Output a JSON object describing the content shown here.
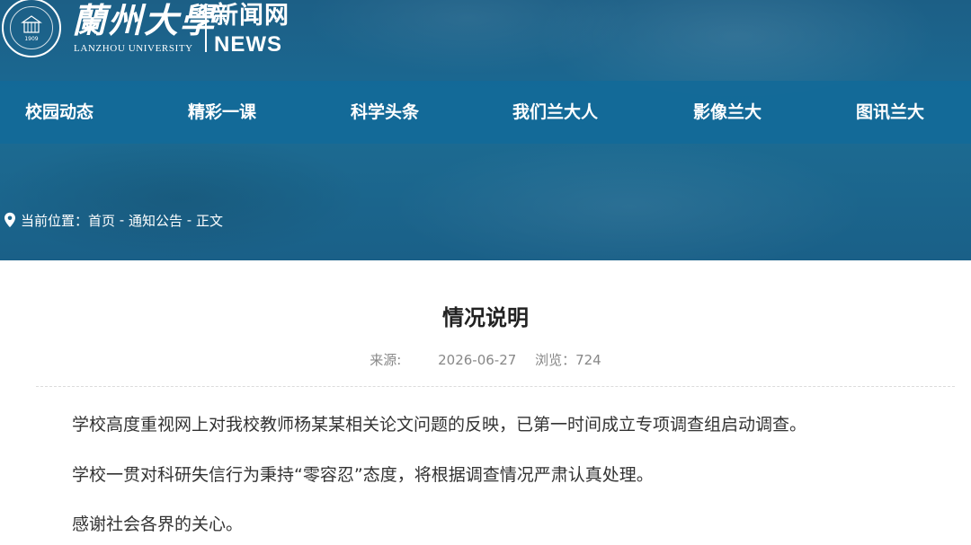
{
  "header": {
    "brand_cn": "蘭州大學",
    "brand_en": "LANZHOU UNIVERSITY",
    "news_cn": "新闻网",
    "news_en": "NEWS",
    "seal_year": "1909"
  },
  "nav": {
    "items": [
      {
        "label": "校园动态"
      },
      {
        "label": "精彩一课"
      },
      {
        "label": "科学头条"
      },
      {
        "label": "我们兰大人"
      },
      {
        "label": "影像兰大"
      },
      {
        "label": "图讯兰大"
      }
    ]
  },
  "breadcrumb": {
    "prefix": "当前位置：",
    "home": "首页",
    "sep1": " - ",
    "section": "通知公告",
    "sep2": " - ",
    "current": "正文"
  },
  "article": {
    "title": "情况说明",
    "source_label": "来源:",
    "source_value": "",
    "date": "2026-06-27",
    "views_label": "浏览：",
    "views": "724",
    "paragraphs": [
      "学校高度重视网上对我校教师杨某某相关论文问题的反映，已第一时间成立专项调查组启动调查。",
      "学校一贯对科研失信行为秉持“零容忍”态度，将根据调查情况严肃认真处理。",
      "感谢社会各界的关心。"
    ]
  },
  "colors": {
    "header_bg": "#1b6790",
    "nav_bg": "#126a98",
    "title_text": "#222222",
    "meta_text": "#888888",
    "body_text": "#333333"
  },
  "icons": {
    "location": "location-pin-icon",
    "seal": "university-seal-icon"
  }
}
